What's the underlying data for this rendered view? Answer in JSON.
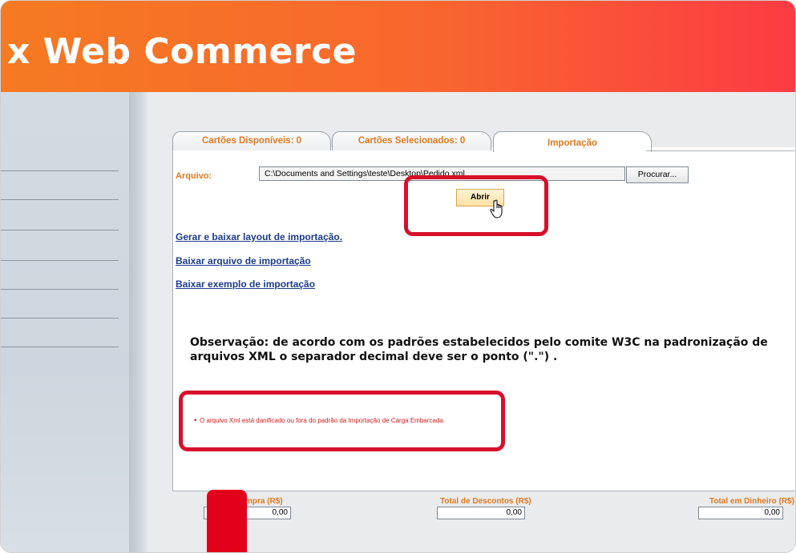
{
  "header": {
    "title": "x Web Commerce"
  },
  "tabs": [
    {
      "label": "Cartões Disponíveis: 0"
    },
    {
      "label": "Cartões Selecionados: 0"
    },
    {
      "label": "Importação"
    }
  ],
  "import": {
    "file_label": "Arquivo:",
    "file_path": "C:\\Documents and Settings\\teste\\Desktop\\Pedido.xml",
    "browse_label": "Procurar...",
    "open_label": "Abrir"
  },
  "links": {
    "generate_layout": "Gerar e baixar layout de importação.",
    "download_file": "Baixar arquivo de importação",
    "download_example": "Baixar exemplo de importação"
  },
  "observation": "Observação: de acordo com os padrões estabelecidos pelo comite W3C na padronização de arquivos XML o separador decimal deve ser o ponto (\".\") .",
  "errors": [
    "O arquivo Xml está danificado ou fora do padrão da Importação de Carga Embarcada."
  ],
  "totals": [
    {
      "label": "mpra (R$)",
      "value": "0,00"
    },
    {
      "label": "Total de Descontos (R$)",
      "value": "0,00"
    },
    {
      "label": "Total em Dinheiro (R$)",
      "value": "0,00"
    }
  ],
  "colors": {
    "accent": "#e07a1f",
    "banner_start": "#f57a22",
    "banner_end": "#fc3b44",
    "highlight": "#d7102a",
    "error": "#d21b1b",
    "link": "#1b3b8c"
  }
}
